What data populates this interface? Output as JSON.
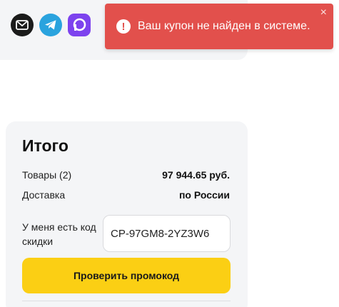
{
  "social": {
    "items": [
      {
        "icon": "email-icon"
      },
      {
        "icon": "telegram-icon"
      },
      {
        "icon": "dzen-icon"
      }
    ]
  },
  "toast": {
    "message": "Ваш купон не найден в системе.",
    "icon_glyph": "!",
    "close_glyph": "×",
    "color": "#e2504c"
  },
  "summary": {
    "title": "Итого",
    "rows": [
      {
        "label": "Товары (2)",
        "value": "97 944.65 руб."
      },
      {
        "label": "Доставка",
        "value": "по России"
      }
    ],
    "coupon": {
      "label": "У меня есть код скидки",
      "value": "CP-97GM8-2YZ3W6"
    },
    "check_button": "Проверить промокод",
    "accent_color": "#fbcf14"
  }
}
